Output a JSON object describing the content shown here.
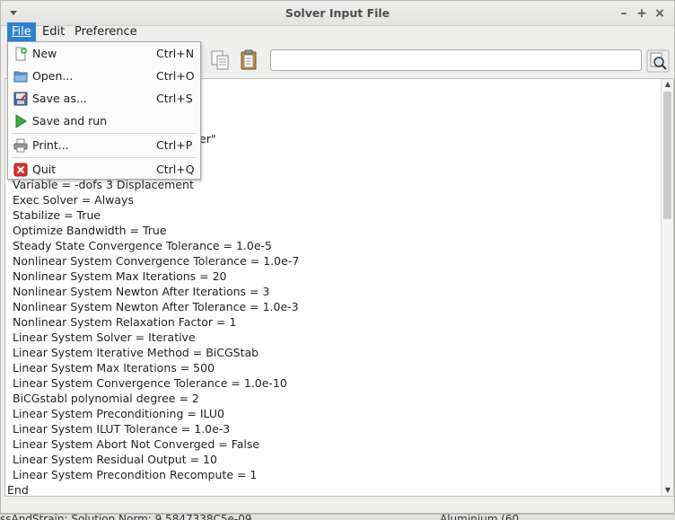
{
  "window": {
    "title": "Solver Input File"
  },
  "menubar": [
    {
      "label": "File",
      "active": true
    },
    {
      "label": "Edit",
      "active": false
    },
    {
      "label": "Preference",
      "active": false
    }
  ],
  "file_menu": {
    "items": [
      {
        "label": "New",
        "shortcut": "Ctrl+N",
        "icon": "new-file-icon"
      },
      {
        "label": "Open...",
        "shortcut": "Ctrl+O",
        "icon": "open-folder-icon"
      },
      {
        "label": "Save as...",
        "shortcut": "Ctrl+S",
        "icon": "save-icon"
      },
      {
        "label": "Save and run",
        "shortcut": "",
        "icon": "play-icon"
      },
      {
        "label": "Print...",
        "shortcut": "Ctrl+P",
        "icon": "printer-icon"
      },
      {
        "label": "Quit",
        "shortcut": "Ctrl+Q",
        "icon": "quit-icon"
      }
    ]
  },
  "search": {
    "value": ""
  },
  "editor": {
    "hidden_fragment": "er\"",
    "lines": [
      "Variable = -dofs 3 Displacement",
      "Exec Solver = Always",
      "Stabilize = True",
      "Optimize Bandwidth = True",
      "Steady State Convergence Tolerance = 1.0e-5",
      "Nonlinear System Convergence Tolerance = 1.0e-7",
      "Nonlinear System Max Iterations = 20",
      "Nonlinear System Newton After Iterations = 3",
      "Nonlinear System Newton After Tolerance = 1.0e-3",
      "Nonlinear System Relaxation Factor = 1",
      "Linear System Solver = Iterative",
      "Linear System Iterative Method = BiCGStab",
      "Linear System Max Iterations = 500",
      "Linear System Convergence Tolerance = 1.0e-10",
      "BiCGstabl polynomial degree = 2",
      "Linear System Preconditioning = ILU0",
      "Linear System ILUT Tolerance = 1.0e-3",
      "Linear System Abort Not Converged = False",
      "Linear System Residual Output = 10",
      "Linear System Precondition Recompute = 1",
      "End"
    ]
  },
  "statusbar": {
    "left": "ssAndStrain: Solution Norm: 9.5847338C5e-09",
    "right": "Aluminium (60"
  },
  "colors": {
    "accent": "#2f7fd0",
    "quit_red": "#d9302c",
    "play_green": "#3caa3c"
  }
}
